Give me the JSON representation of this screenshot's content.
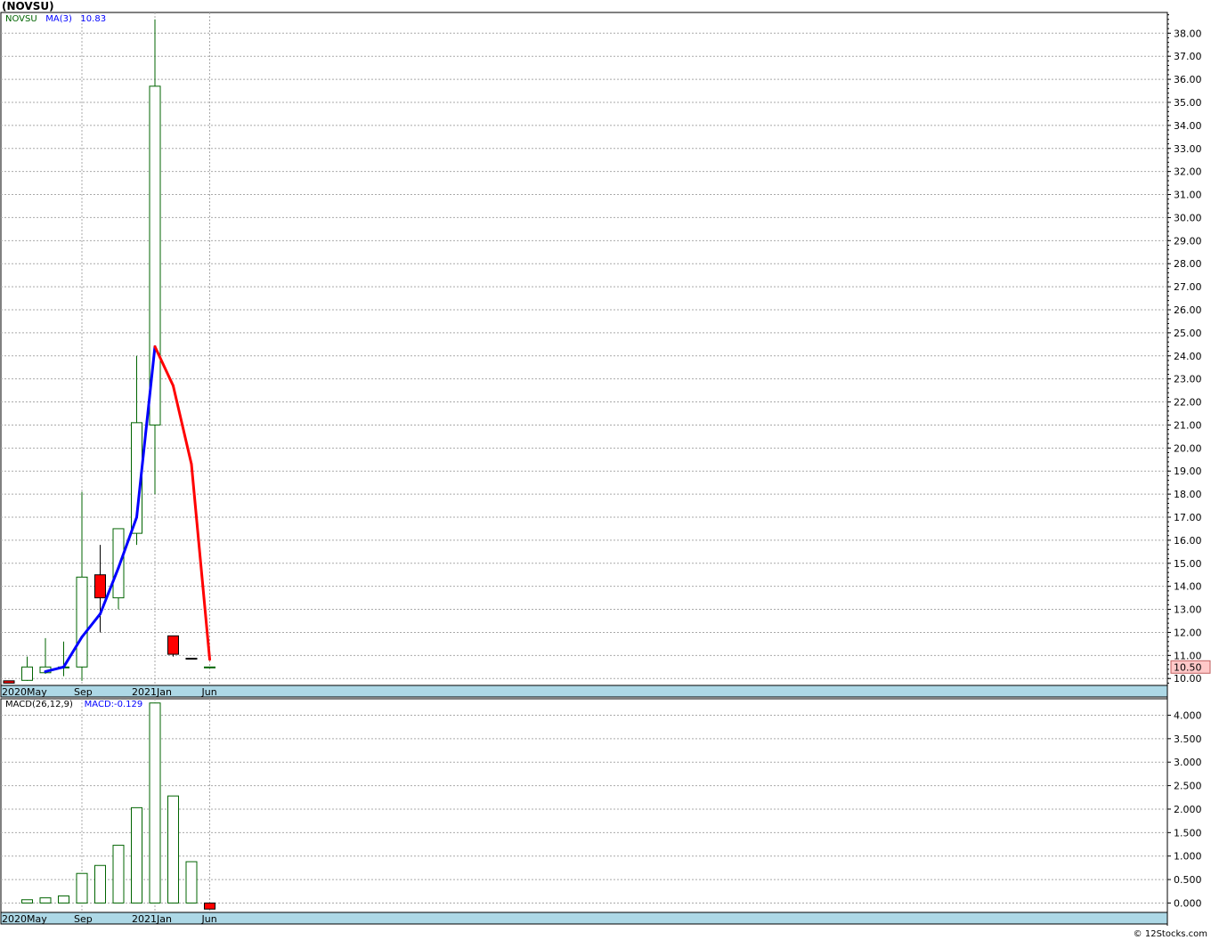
{
  "title": "(NOVSU)",
  "credit": "© 12Stocks.com",
  "price_panel": {
    "symbol": "NOVSU",
    "ma_label": "MA(3)",
    "ma_value": "10.83",
    "last_price_label": "10.50"
  },
  "macd_panel": {
    "label": "MACD(26,12,9)",
    "value_label": "MACD:-0.129"
  },
  "x_axis": {
    "labels": [
      {
        "text": "2020May",
        "month": 0
      },
      {
        "text": "Sep",
        "month": 4
      },
      {
        "text": "2021Jan",
        "month": 8
      },
      {
        "text": "Jun",
        "month": 11
      }
    ]
  },
  "colors": {
    "up_body": "#ffffff",
    "up_line": "#006400",
    "down_body": "#ff0000",
    "ma_up": "#0000ff",
    "ma_down": "#ff0000",
    "axis_band": "#add8e6",
    "grid": "#a9a9a9",
    "last_price_bg": "#ffc8c8"
  },
  "chart_data": [
    {
      "type": "candlestick",
      "title": "",
      "ylim": [
        9.7,
        38.9
      ],
      "ytick_labels": [
        "10.00",
        "11.00",
        "12.00",
        "13.00",
        "14.00",
        "15.00",
        "16.00",
        "17.00",
        "18.00",
        "19.00",
        "20.00",
        "21.00",
        "22.00",
        "23.00",
        "24.00",
        "25.00",
        "26.00",
        "27.00",
        "28.00",
        "29.00",
        "30.00",
        "31.00",
        "32.00",
        "33.00",
        "34.00",
        "35.00",
        "36.00",
        "37.00",
        "38.00"
      ],
      "candles": [
        {
          "month": 0,
          "open": 9.9,
          "high": 9.9,
          "low": 9.8,
          "close": 9.8
        },
        {
          "month": 1,
          "open": 9.92,
          "high": 10.95,
          "low": 9.9,
          "close": 10.5
        },
        {
          "month": 2,
          "open": 10.25,
          "high": 11.75,
          "low": 10.2,
          "close": 10.5
        },
        {
          "month": 3,
          "open": 10.5,
          "high": 11.6,
          "low": 10.1,
          "close": 10.5
        },
        {
          "month": 4,
          "open": 10.5,
          "high": 18.1,
          "low": 9.9,
          "close": 14.4
        },
        {
          "month": 5,
          "open": 14.5,
          "high": 15.8,
          "low": 12.0,
          "close": 13.5
        },
        {
          "month": 6,
          "open": 13.5,
          "high": 16.5,
          "low": 13.0,
          "close": 16.5
        },
        {
          "month": 7,
          "open": 16.3,
          "high": 24.0,
          "low": 15.8,
          "close": 21.1
        },
        {
          "month": 8,
          "open": 21.0,
          "high": 38.6,
          "low": 18.0,
          "close": 35.7
        },
        {
          "month": 9,
          "open": 11.85,
          "high": 11.85,
          "low": 10.95,
          "close": 11.05
        },
        {
          "month": 10,
          "open": 10.88,
          "high": 10.88,
          "low": 10.86,
          "close": 10.87
        },
        {
          "month": 11,
          "open": 10.5,
          "high": 10.5,
          "low": 10.49,
          "close": 10.5
        }
      ],
      "ma3": [
        {
          "month": 2,
          "value": 10.3
        },
        {
          "month": 3,
          "value": 10.5
        },
        {
          "month": 4,
          "value": 11.8
        },
        {
          "month": 5,
          "value": 12.8
        },
        {
          "month": 6,
          "value": 14.8
        },
        {
          "month": 7,
          "value": 17.0
        },
        {
          "month": 8,
          "value": 24.4
        },
        {
          "month": 9,
          "value": 22.7
        },
        {
          "month": 10,
          "value": 19.3
        },
        {
          "month": 11,
          "value": 10.83
        }
      ]
    },
    {
      "type": "bar",
      "title": "",
      "ylim": [
        -0.2,
        4.35
      ],
      "ytick_labels": [
        "0.000",
        "0.500",
        "1.000",
        "1.500",
        "2.000",
        "2.500",
        "3.000",
        "3.500",
        "4.000"
      ],
      "bars": [
        {
          "month": 1,
          "value": 0.07
        },
        {
          "month": 2,
          "value": 0.11
        },
        {
          "month": 3,
          "value": 0.15
        },
        {
          "month": 4,
          "value": 0.63
        },
        {
          "month": 5,
          "value": 0.8
        },
        {
          "month": 6,
          "value": 1.23
        },
        {
          "month": 7,
          "value": 2.03
        },
        {
          "month": 8,
          "value": 4.26
        },
        {
          "month": 9,
          "value": 2.28
        },
        {
          "month": 10,
          "value": 0.88
        },
        {
          "month": 11,
          "value": -0.129
        }
      ]
    }
  ]
}
